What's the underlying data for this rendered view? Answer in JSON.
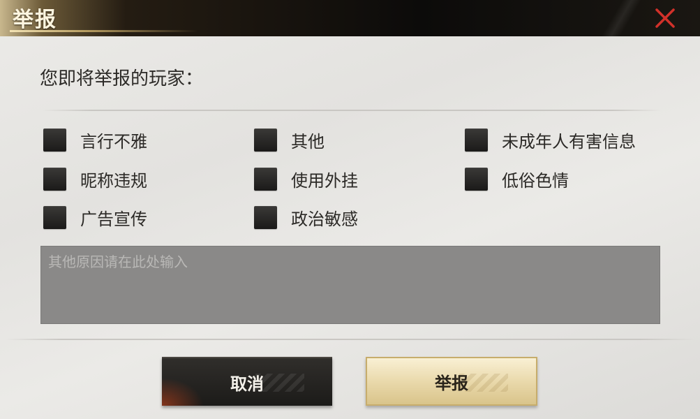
{
  "dialog": {
    "title": "举报",
    "close_icon": "close-icon",
    "prompt": "您即将举报的玩家："
  },
  "reasons": [
    {
      "label": "言行不雅",
      "checked": false
    },
    {
      "label": "其他",
      "checked": false
    },
    {
      "label": "未成年人有害信息",
      "checked": false
    },
    {
      "label": "昵称违规",
      "checked": false
    },
    {
      "label": "使用外挂",
      "checked": false
    },
    {
      "label": "低俗色情",
      "checked": false
    },
    {
      "label": "广告宣传",
      "checked": false
    },
    {
      "label": "政治敏感",
      "checked": false
    }
  ],
  "input": {
    "value": "",
    "placeholder": "其他原因请在此处输入"
  },
  "buttons": {
    "cancel_label": "取消",
    "report_label": "举报"
  },
  "colors": {
    "close_icon": "#d2312a",
    "title_text": "#fff6e0",
    "cancel_bg": "#252320",
    "report_bg": "#e8d7a8"
  }
}
